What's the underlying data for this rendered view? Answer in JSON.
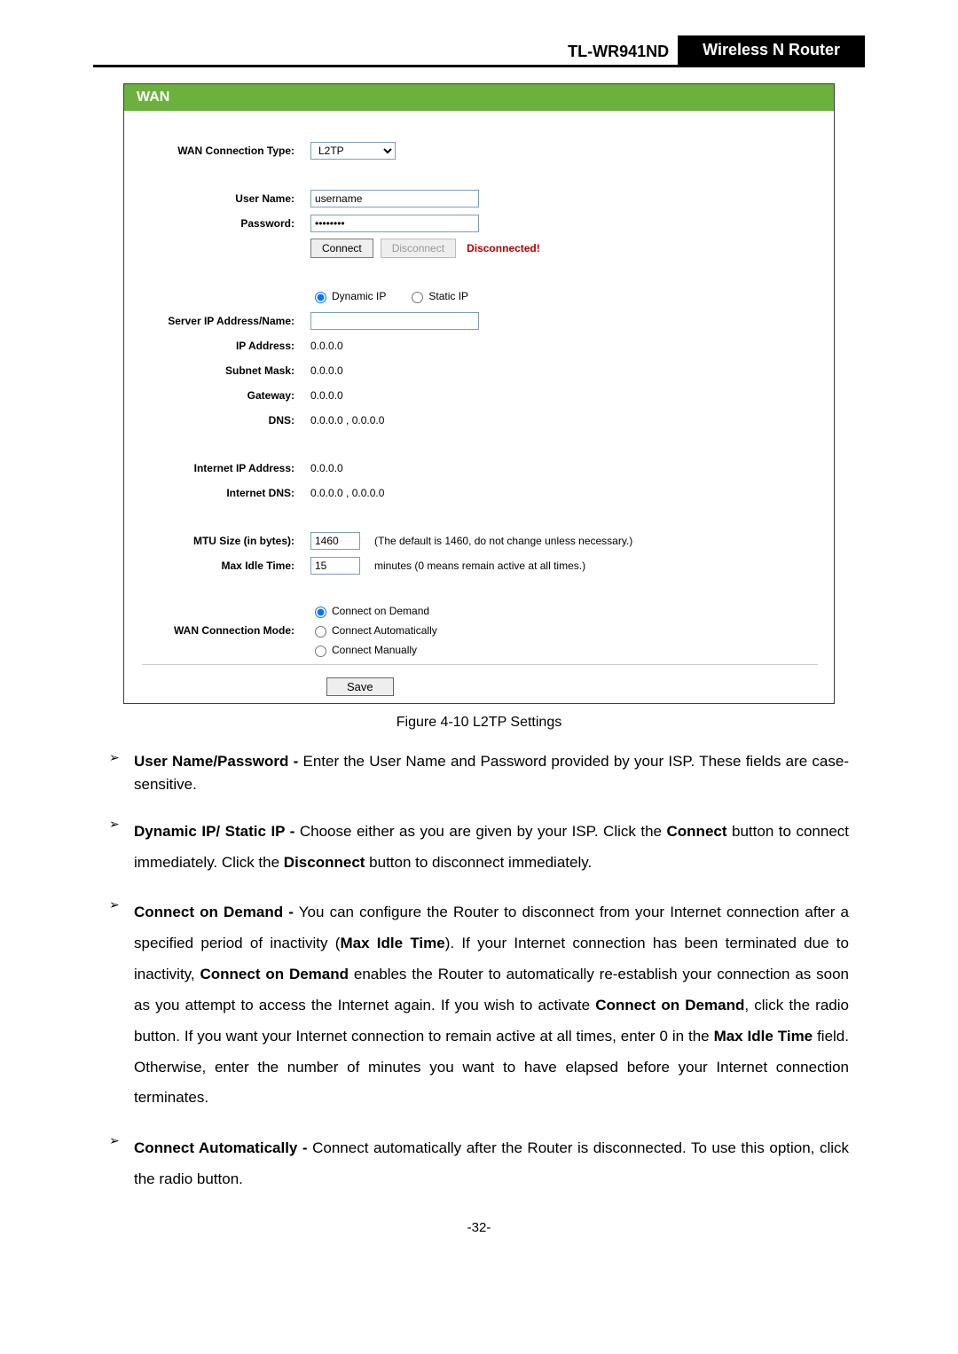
{
  "header": {
    "model": "TL-WR941ND",
    "product": "Wireless  N  Router"
  },
  "panel": {
    "title": "WAN",
    "labels": {
      "conn_type": "WAN Connection Type:",
      "user_name": "User Name:",
      "password": "Password:",
      "server_ip": "Server IP Address/Name:",
      "ip_addr": "IP Address:",
      "subnet": "Subnet Mask:",
      "gateway": "Gateway:",
      "dns": "DNS:",
      "inet_ip": "Internet IP Address:",
      "inet_dns": "Internet DNS:",
      "mtu": "MTU Size (in bytes):",
      "max_idle": "Max Idle Time:",
      "conn_mode": "WAN Connection Mode:"
    },
    "values": {
      "conn_type_option": "L2TP",
      "user_name": "username",
      "password": "••••••••",
      "connect_btn": "Connect",
      "disconnect_btn": "Disconnect",
      "status": "Disconnected!",
      "ip_type_dynamic": "Dynamic IP",
      "ip_type_static": "Static IP",
      "server_ip": "",
      "ip_addr": "0.0.0.0",
      "subnet": "0.0.0.0",
      "gateway": "0.0.0.0",
      "dns": "0.0.0.0 , 0.0.0.0",
      "inet_ip": "0.0.0.0",
      "inet_dns": "0.0.0.0 , 0.0.0.0",
      "mtu": "1460",
      "mtu_hint": "(The default is 1460, do not change unless necessary.)",
      "max_idle": "15",
      "max_idle_hint": "minutes (0 means remain active at all times.)",
      "mode_on_demand": "Connect on Demand",
      "mode_auto": "Connect Automatically",
      "mode_manual": "Connect Manually",
      "save_btn": "Save"
    }
  },
  "figure_caption": "Figure 4-10    L2TP Settings",
  "bullets": {
    "b1_strong": "User Name/Password -",
    "b1_rest": " Enter the User Name and Password provided by your ISP. These fields are case-sensitive.",
    "b2_strong": "Dynamic IP/ Static IP -",
    "b2_a": " Choose either as you are given by your ISP. Click the ",
    "b2_b": "Connect",
    "b2_c": " button to connect immediately. Click the ",
    "b2_d": "Disconnect",
    "b2_e": " button to disconnect immediately.",
    "b3_strong": "Connect on Demand -",
    "b3_a": " You can configure the Router to disconnect from your Internet connection after a specified period of inactivity (",
    "b3_b": "Max Idle Time",
    "b3_c": "). If your Internet connection has been terminated due to inactivity, ",
    "b3_d": "Connect on Demand",
    "b3_e": " enables the Router to automatically re-establish your connection as soon as you attempt to access the Internet again. If you wish to activate ",
    "b3_f": "Connect on Demand",
    "b3_g": ", click the radio button. If you want your Internet connection to remain active at all times, enter 0 in the ",
    "b3_h": "Max Idle Time",
    "b3_i": " field. Otherwise, enter the number of minutes you want to have elapsed before your Internet connection terminates.",
    "b4_strong": "Connect Automatically -",
    "b4_rest": " Connect automatically after the Router is disconnected. To use this option, click the radio button."
  },
  "page_number": "-32-"
}
